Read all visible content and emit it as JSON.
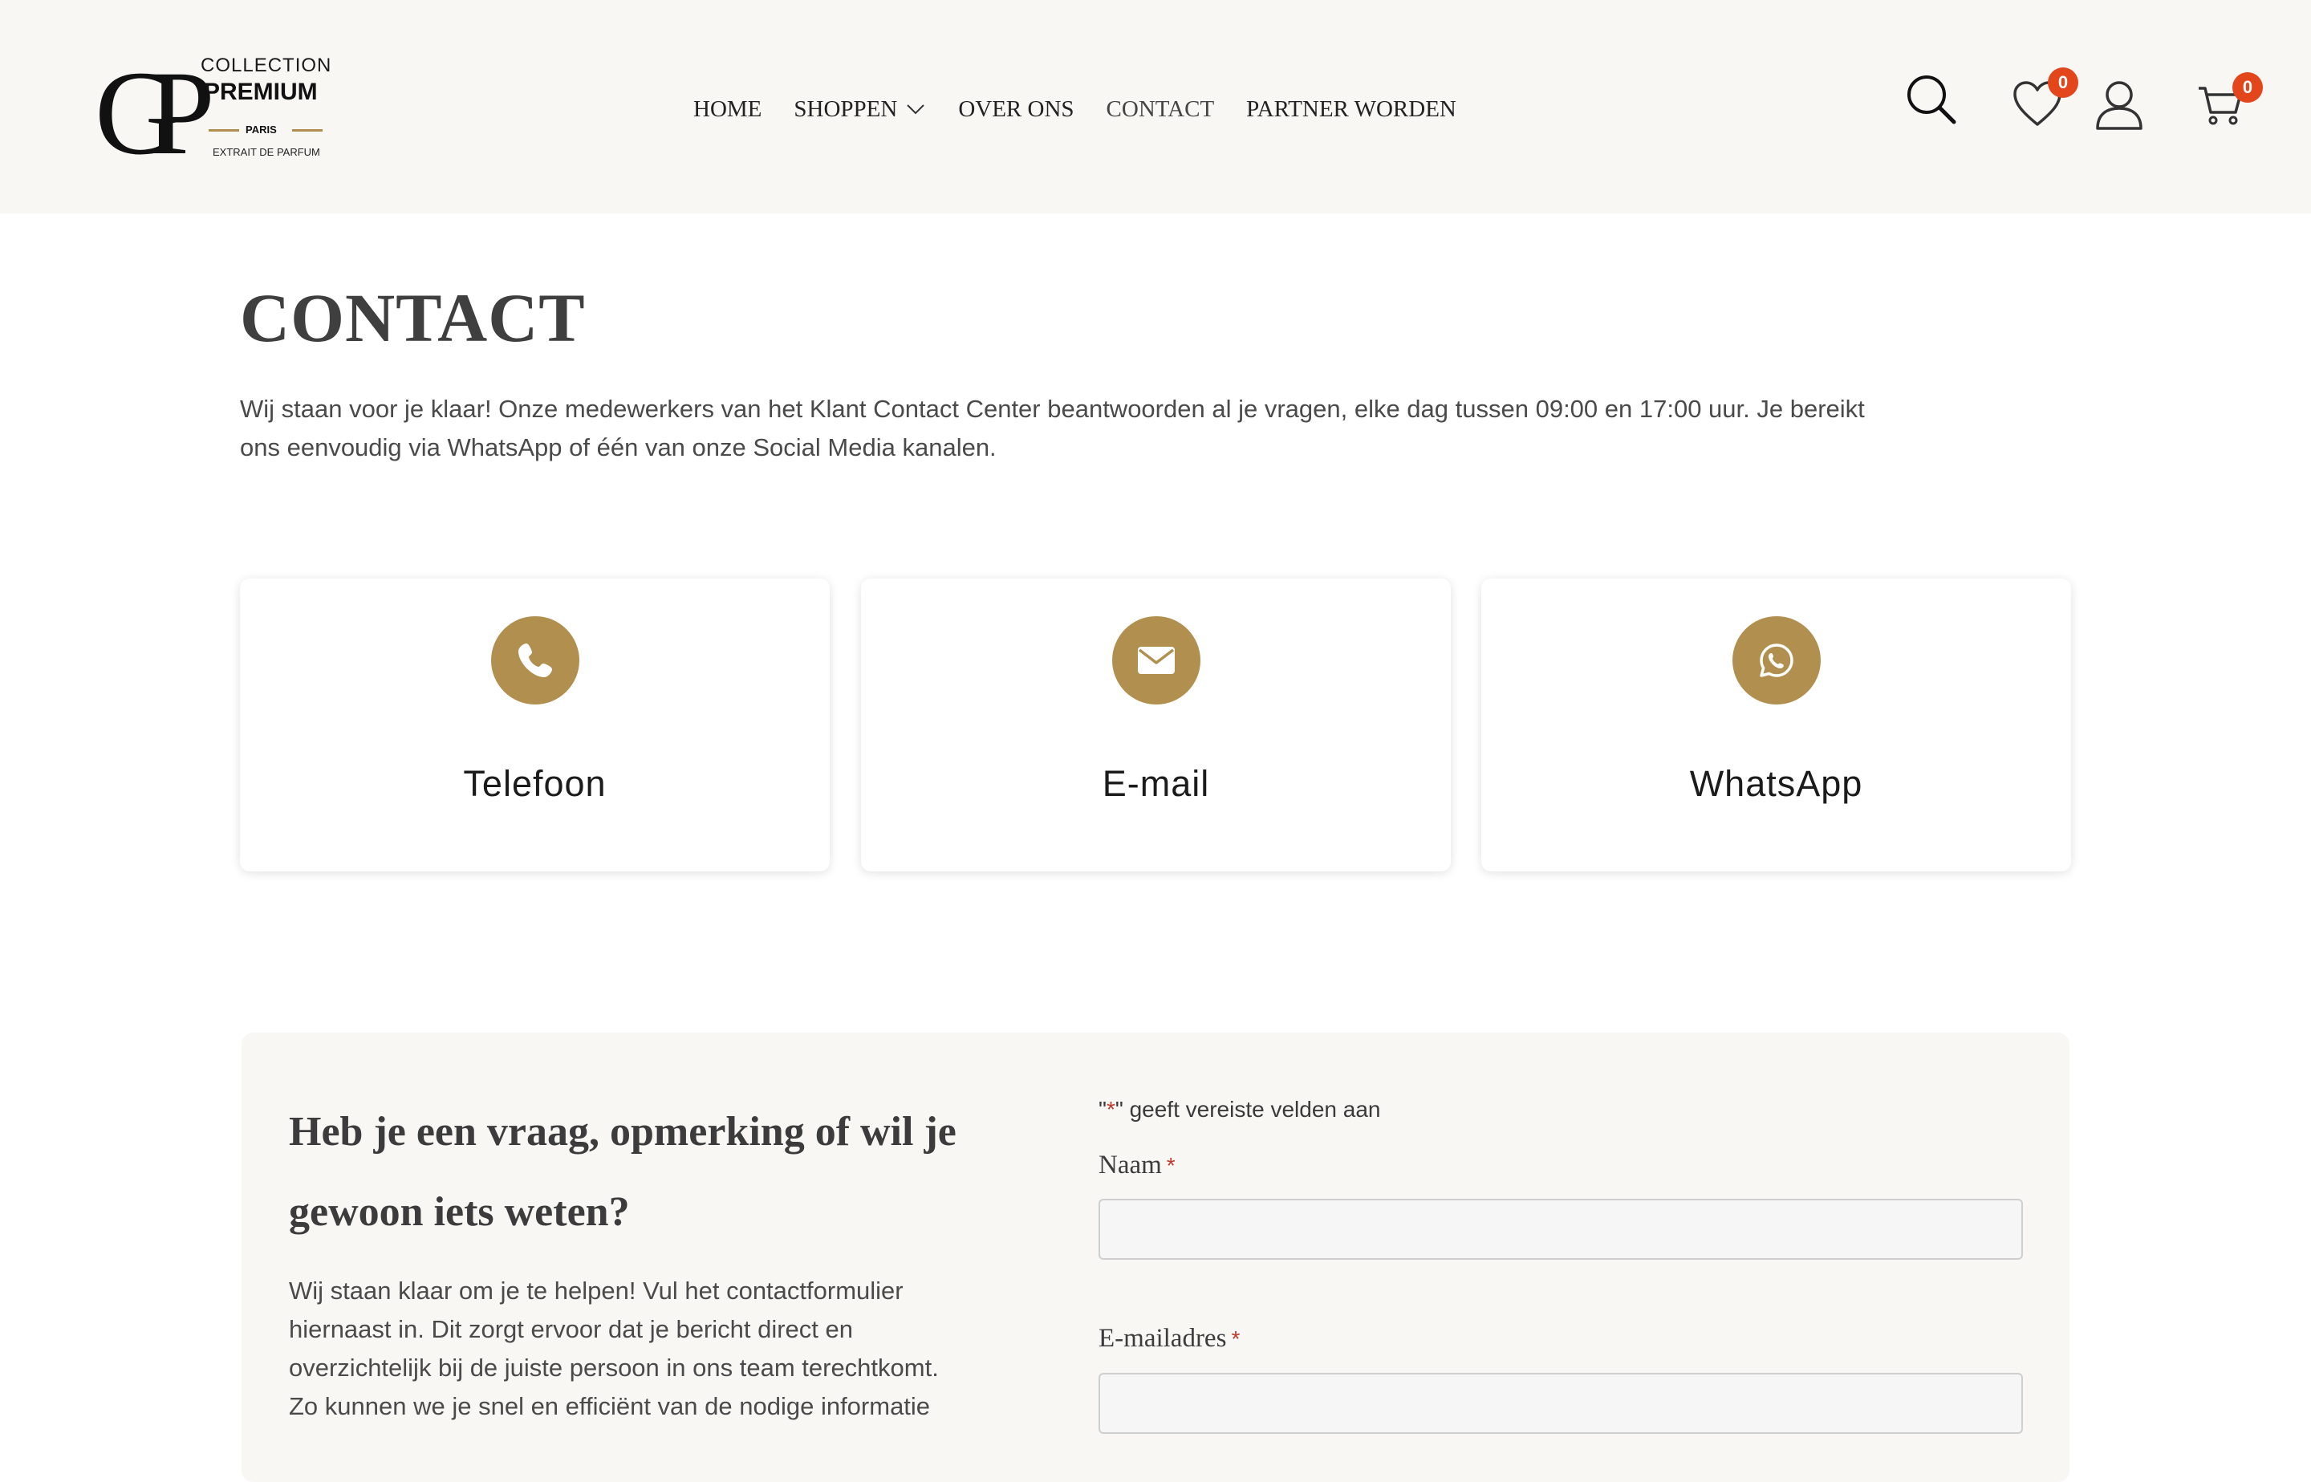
{
  "logo": {
    "monogram": "GP",
    "line1": "COLLECTION",
    "line2": "PREMIUM",
    "line3": "PARIS",
    "line4": "EXTRAIT DE PARFUM"
  },
  "nav": {
    "items": [
      {
        "label": "HOME"
      },
      {
        "label": "SHOPPEN"
      },
      {
        "label": "OVER ONS"
      },
      {
        "label": "CONTACT"
      },
      {
        "label": "PARTNER WORDEN"
      }
    ]
  },
  "header_icons": {
    "search": "search-icon",
    "wishlist": "heart-icon",
    "account": "user-icon",
    "cart": "cart-icon",
    "wishlist_count": "0",
    "cart_count": "0",
    "badge_color": "#e3461b"
  },
  "page": {
    "title": "CONTACT",
    "intro": "Wij staan voor je klaar! Onze medewerkers van het Klant Contact Center beantwoorden al je vragen, elke dag tussen 09:00 en 17:00 uur. Je bereikt ons eenvoudig via WhatsApp of één van onze Social Media kanalen."
  },
  "contact_cards": [
    {
      "label": "Telefoon",
      "icon": "phone-icon"
    },
    {
      "label": "E-mail",
      "icon": "envelope-icon"
    },
    {
      "label": "WhatsApp",
      "icon": "whatsapp-icon"
    }
  ],
  "accent_color": "#b1904f",
  "form_section": {
    "heading": "Heb je een vraag, opmerking of wil je gewoon iets weten?",
    "text": "Wij staan klaar om je te helpen! Vul het contactformulier hiernaast in. Dit zorgt ervoor dat je bericht direct en overzichtelijk bij de juiste persoon in ons team terechtkomt. Zo kunnen we je snel en efficiënt van de nodige informatie",
    "required_note_quote_open": "\"",
    "required_note_star": "*",
    "required_note_rest": "\" geeft vereiste velden aan",
    "fields": [
      {
        "label": "Naam",
        "required_mark": "*",
        "value": ""
      },
      {
        "label": "E-mailadres",
        "required_mark": "*",
        "value": ""
      }
    ]
  }
}
